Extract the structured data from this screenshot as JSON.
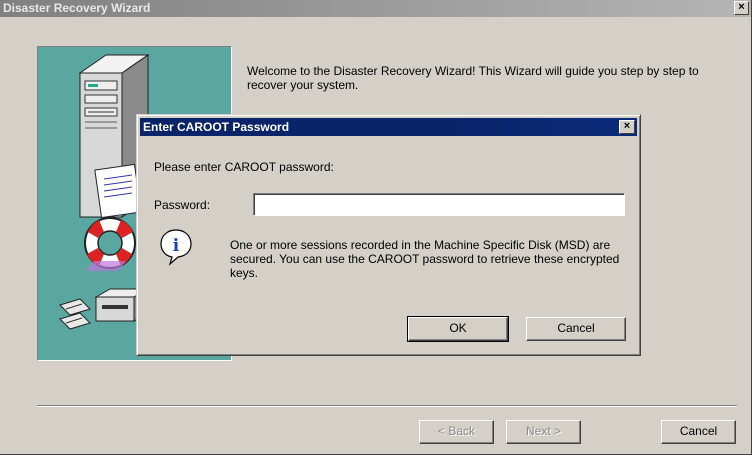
{
  "wizard": {
    "title": "Disaster Recovery Wizard",
    "close_glyph": "×",
    "welcome_text": "Welcome to the Disaster Recovery Wizard! This Wizard will guide you step by step to recover your system.",
    "buttons": {
      "back": "< Back",
      "next": "Next >",
      "cancel": "Cancel"
    }
  },
  "dialog": {
    "title": "Enter CAROOT Password",
    "close_glyph": "×",
    "prompt": "Please enter CAROOT password:",
    "password_label": "Password:",
    "password_value": "",
    "info_icon_glyph": "i",
    "message": "One or more sessions recorded in the Machine Specific Disk (MSD) are secured. You can use the CAROOT password to retrieve these encrypted keys.",
    "buttons": {
      "ok": "OK",
      "cancel": "Cancel"
    }
  },
  "colors": {
    "dialog_title_bar": "#0a246a",
    "inactive_title_bar": "#808080",
    "face": "#d4d0c8",
    "illustration_bg": "#5aa6a1"
  },
  "icons": {
    "illustration": "computer-recovery-illustration",
    "info": "info-icon",
    "close": "close-icon"
  }
}
